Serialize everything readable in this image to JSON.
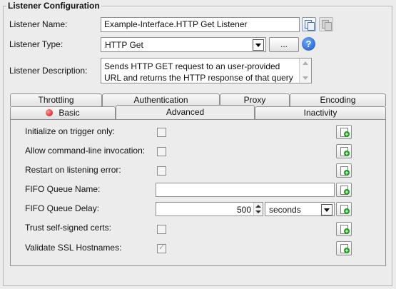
{
  "group_title": "Listener Configuration",
  "fields": {
    "name_label": "Listener Name:",
    "name_value": "Example-Interface.HTTP Get Listener",
    "type_label": "Listener Type:",
    "type_value": "HTTP Get",
    "browse_label": "...",
    "help_glyph": "?",
    "description_label": "Listener Description:",
    "description_line1": "Sends HTTP GET request to an user-provided",
    "description_line2": "URL and returns the HTTP response of that query"
  },
  "tabs": {
    "row_back": [
      "Throttling",
      "Authentication",
      "Proxy",
      "Encoding"
    ],
    "row_front": [
      "Basic",
      "Advanced",
      "Inactivity"
    ],
    "active": "Advanced"
  },
  "advanced": {
    "initialize_on_trigger_label": "Initialize on trigger only:",
    "initialize_on_trigger_checked": false,
    "allow_cli_label": "Allow command-line invocation:",
    "allow_cli_checked": false,
    "restart_on_error_label": "Restart on listening error:",
    "restart_on_error_checked": false,
    "fifo_name_label": "FIFO Queue Name:",
    "fifo_name_value": "",
    "fifo_delay_label": "FIFO Queue Delay:",
    "fifo_delay_value": "500",
    "fifo_delay_unit": "seconds",
    "trust_self_signed_label": "Trust self-signed certs:",
    "trust_self_signed_checked": false,
    "validate_ssl_label": "Validate SSL Hostnames:",
    "validate_ssl_checked": true
  },
  "icons": {
    "copy": "copy-icon",
    "paste": "paste-icon",
    "help": "help-icon",
    "add_variable": "add-variable-icon",
    "basic_tab_status": "error-status-icon"
  },
  "colors": {
    "help_blue": "#1553c9",
    "status_red": "#d40000",
    "add_green": "#1a9a1a"
  }
}
